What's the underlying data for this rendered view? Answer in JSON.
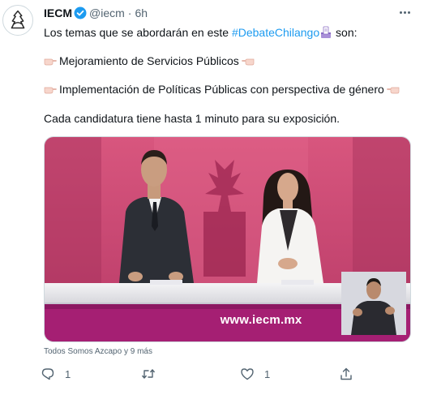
{
  "tweet": {
    "author_name": "IECM",
    "handle": "@iecm",
    "separator": "·",
    "time": "6h",
    "verified": true,
    "intro": "Los temas que se abordarán en este ",
    "hashtag": "#DebateChilango",
    "intro_after": " son:",
    "topic_1": "Mejoramiento de Servicios Públicos",
    "topic_2": "Implementación de Políticas Públicas con perspectiva de género",
    "closing": "Cada candidatura tiene hasta 1 minuto para su exposición.",
    "video_caption": "www.iecm.mx",
    "tagged_people": "Todos Somos Azcapo y 9 más",
    "reply_count": "1",
    "retweet_count": "",
    "like_count": "1",
    "icons": {
      "avatar": "iecm-logo-icon",
      "verified": "verified-badge-icon",
      "more": "more-options-icon",
      "pointing": "pointing-hand-emoji-icon",
      "ballot": "ballot-box-emoji-icon",
      "reply": "reply-icon",
      "retweet": "retweet-icon",
      "like": "heart-icon",
      "share": "share-icon"
    },
    "colors": {
      "accent": "#1d9bf0",
      "studio_pink": "#c94a74",
      "banner_magenta": "#b1237a"
    }
  }
}
